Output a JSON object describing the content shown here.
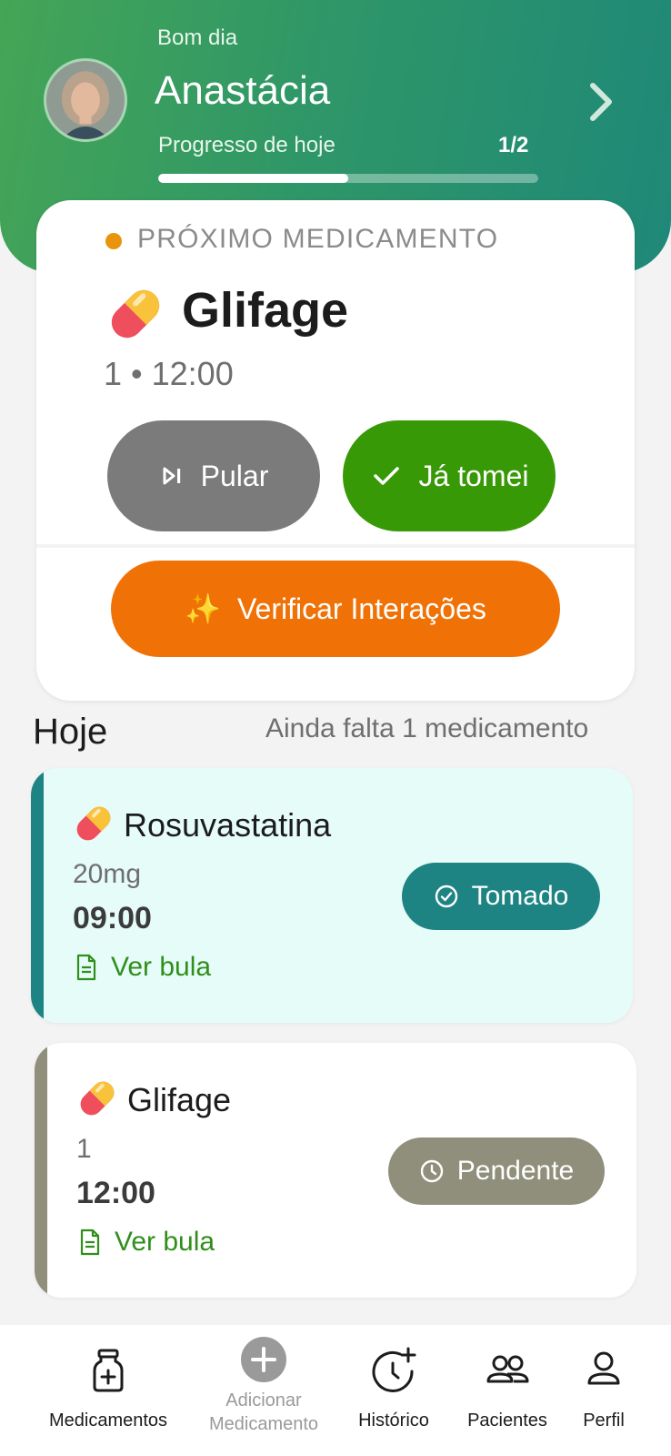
{
  "header": {
    "greeting": "Bom dia",
    "user_name": "Anastácia",
    "progress_label": "Progresso de hoje",
    "progress_count": "1/2",
    "progress_fraction": 0.5
  },
  "next_medication": {
    "label": "PRÓXIMO MEDICAMENTO",
    "name": "Glifage",
    "dose_time": "1 • 12:00",
    "skip_label": "Pular",
    "taken_label": "Já tomei",
    "interactions_label": "Verificar Interações",
    "interactions_icon": "✨"
  },
  "today": {
    "title": "Hoje",
    "remaining": "Ainda falta 1 medicamento"
  },
  "medications": [
    {
      "name": "Rosuvastatina",
      "dose": "20mg",
      "time": "09:00",
      "bula_label": "Ver bula",
      "status": "Tomado",
      "status_color": "#1e8483",
      "strip_color": "#1e8483",
      "card_bg": "#e6fcf9"
    },
    {
      "name": "Glifage",
      "dose": "1",
      "time": "12:00",
      "bula_label": "Ver bula",
      "status": "Pendente",
      "status_color": "#8f8f7c",
      "strip_color": "#8f8f7c",
      "card_bg": "#ffffff"
    }
  ],
  "nav": {
    "items": [
      {
        "label": "Medicamentos",
        "icon": "medicine-bottle-icon"
      },
      {
        "label": "Adicionar Medicamento",
        "icon": "plus-circle-icon"
      },
      {
        "label": "Histórico",
        "icon": "history-clock-icon"
      },
      {
        "label": "Pacientes",
        "icon": "people-icon"
      },
      {
        "label": "Perfil",
        "icon": "person-icon"
      }
    ]
  },
  "colors": {
    "header_start": "#45a556",
    "header_end": "#1f8878",
    "accent_orange": "#f07207",
    "taken_green": "#389907",
    "skip_gray": "#7b7b7b",
    "link_green": "#2f8f1a"
  }
}
